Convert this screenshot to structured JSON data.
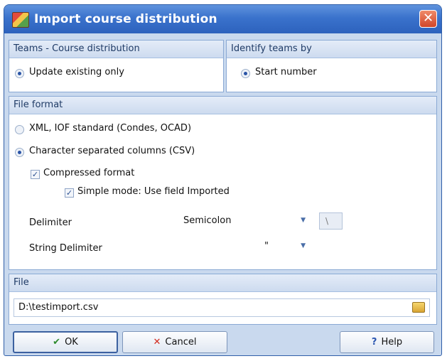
{
  "window": {
    "title": "Import course distribution",
    "close_glyph": "✕"
  },
  "teams_panel": {
    "header": "Teams - Course distribution",
    "option": "Update existing only",
    "selected": true
  },
  "identify_panel": {
    "header": "Identify teams by",
    "option": "Start number",
    "selected": true
  },
  "file_format": {
    "header": "File format",
    "options": [
      {
        "label": "XML, IOF standard (Condes, OCAD)",
        "selected": false
      },
      {
        "label": "Character separated columns (CSV)",
        "selected": true
      }
    ],
    "compressed": {
      "label": "Compressed format",
      "checked": true
    },
    "simple_mode": {
      "label": "Simple mode: Use field Imported",
      "checked": true
    },
    "delimiter": {
      "label": "Delimiter",
      "value": "Semicolon",
      "custom_value": "\\"
    },
    "string_delimiter": {
      "label": "String Delimiter",
      "value": "\""
    }
  },
  "file_panel": {
    "header": "File",
    "path": "D:\\testimport.csv",
    "browse_icon": "folder-icon"
  },
  "buttons": {
    "ok": "OK",
    "cancel": "Cancel",
    "help": "Help"
  },
  "colors": {
    "title_bar": "#3a72cc",
    "panel_header_text": "#1f3b66",
    "ok_check": "#2e8b2e",
    "cancel_x": "#d22a1e",
    "help_icon": "#2a56b0"
  }
}
